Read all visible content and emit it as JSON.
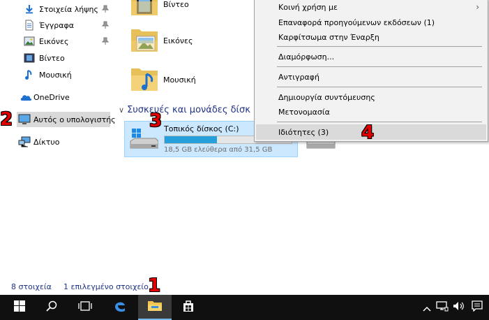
{
  "sidebar": {
    "items": [
      {
        "label": "Στοιχεία λήψης",
        "icon": "downloads-icon",
        "pinned": true
      },
      {
        "label": "Έγγραφα",
        "icon": "documents-icon",
        "pinned": true
      },
      {
        "label": "Εικόνες",
        "icon": "pictures-icon",
        "pinned": true
      },
      {
        "label": "Βίντεο",
        "icon": "videos-icon",
        "pinned": false
      },
      {
        "label": "Μουσική",
        "icon": "music-icon",
        "pinned": false
      },
      {
        "label": "OneDrive",
        "icon": "onedrive-icon",
        "pinned": false
      },
      {
        "label": "Αυτός ο υπολογιστής",
        "icon": "this-pc-icon",
        "pinned": false,
        "selected": true
      },
      {
        "label": "Δίκτυο",
        "icon": "network-icon",
        "pinned": false
      }
    ]
  },
  "main": {
    "folders": [
      {
        "label": "Βίντεο",
        "icon": "videos-folder-icon"
      },
      {
        "label": "Εικόνες",
        "icon": "pictures-folder-icon"
      },
      {
        "label": "Μουσική",
        "icon": "music-folder-icon"
      }
    ],
    "section_header": "Συσκευές και μονάδες δίσκ",
    "drive": {
      "name": "Τοπικός δίσκος (C:)",
      "free_text": "18,5 GB ελεύθερα από 31,5 GB",
      "used_fraction": 0.41
    }
  },
  "context_menu": {
    "items": [
      {
        "label": "Κοινή χρήση με",
        "submenu": true
      },
      {
        "label": "Επαναφορά προηγούμενων εκδόσεων (1)"
      },
      {
        "label": "Καρφίτσωμα στην Έναρξη"
      },
      {
        "label": "Διαμόρφωση..."
      },
      {
        "label": "Αντιγραφή"
      },
      {
        "label": "Δημιουργία συντόμευσης"
      },
      {
        "label": "Μετονομασία"
      },
      {
        "label": "Ιδιότητες (3)",
        "highlighted": true
      }
    ],
    "submenu_arrow": "›"
  },
  "status_bar": {
    "item_count": "8 στοιχεία",
    "selection": "1 επιλεγμένο στοιχείο"
  },
  "taskbar": {
    "buttons": [
      "start-icon",
      "search-icon",
      "task-view-icon",
      "edge-icon",
      "file-explorer-icon",
      "store-icon"
    ],
    "tray": [
      "chevron-up-icon",
      "network-icon",
      "volume-icon",
      "notifications-icon"
    ]
  },
  "steps": [
    "1",
    "2",
    "3",
    "4"
  ],
  "colors": {
    "selection_bg": "#cce8ff",
    "selection_border": "#99d1ff",
    "progress": "#26a0da",
    "link_blue": "#1e3287",
    "step_red": "#e00000",
    "taskbar": "#101010"
  }
}
